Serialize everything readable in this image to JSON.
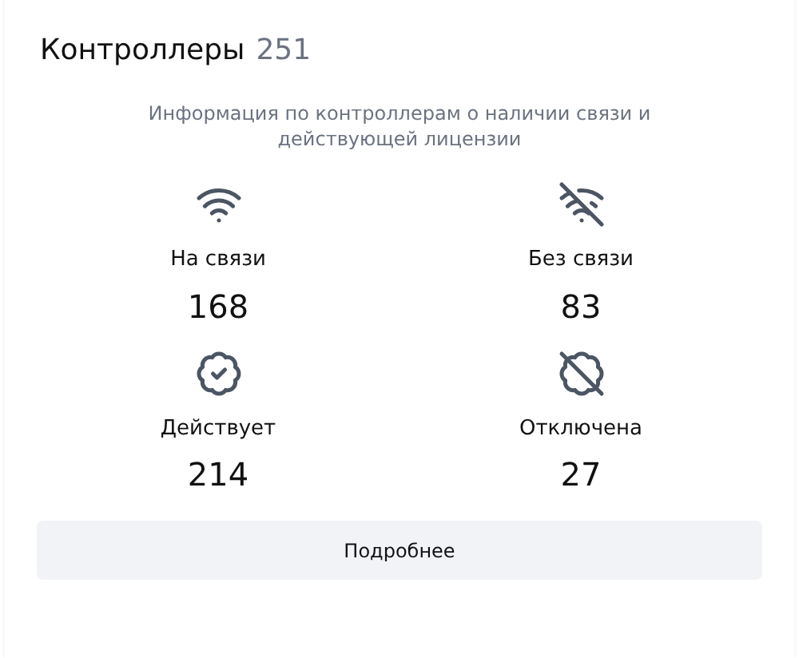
{
  "title": "Контроллеры",
  "count": "251",
  "description": "Информация по контроллерам о наличии связи и действующей лицензии",
  "stats": [
    {
      "kind": "online",
      "label": "На связи",
      "value": "168"
    },
    {
      "kind": "offline",
      "label": "Без связи",
      "value": "83"
    },
    {
      "kind": "active",
      "label": "Действует",
      "value": "214"
    },
    {
      "kind": "disabled",
      "label": "Отключена",
      "value": "27"
    }
  ],
  "button": "Подробнее"
}
